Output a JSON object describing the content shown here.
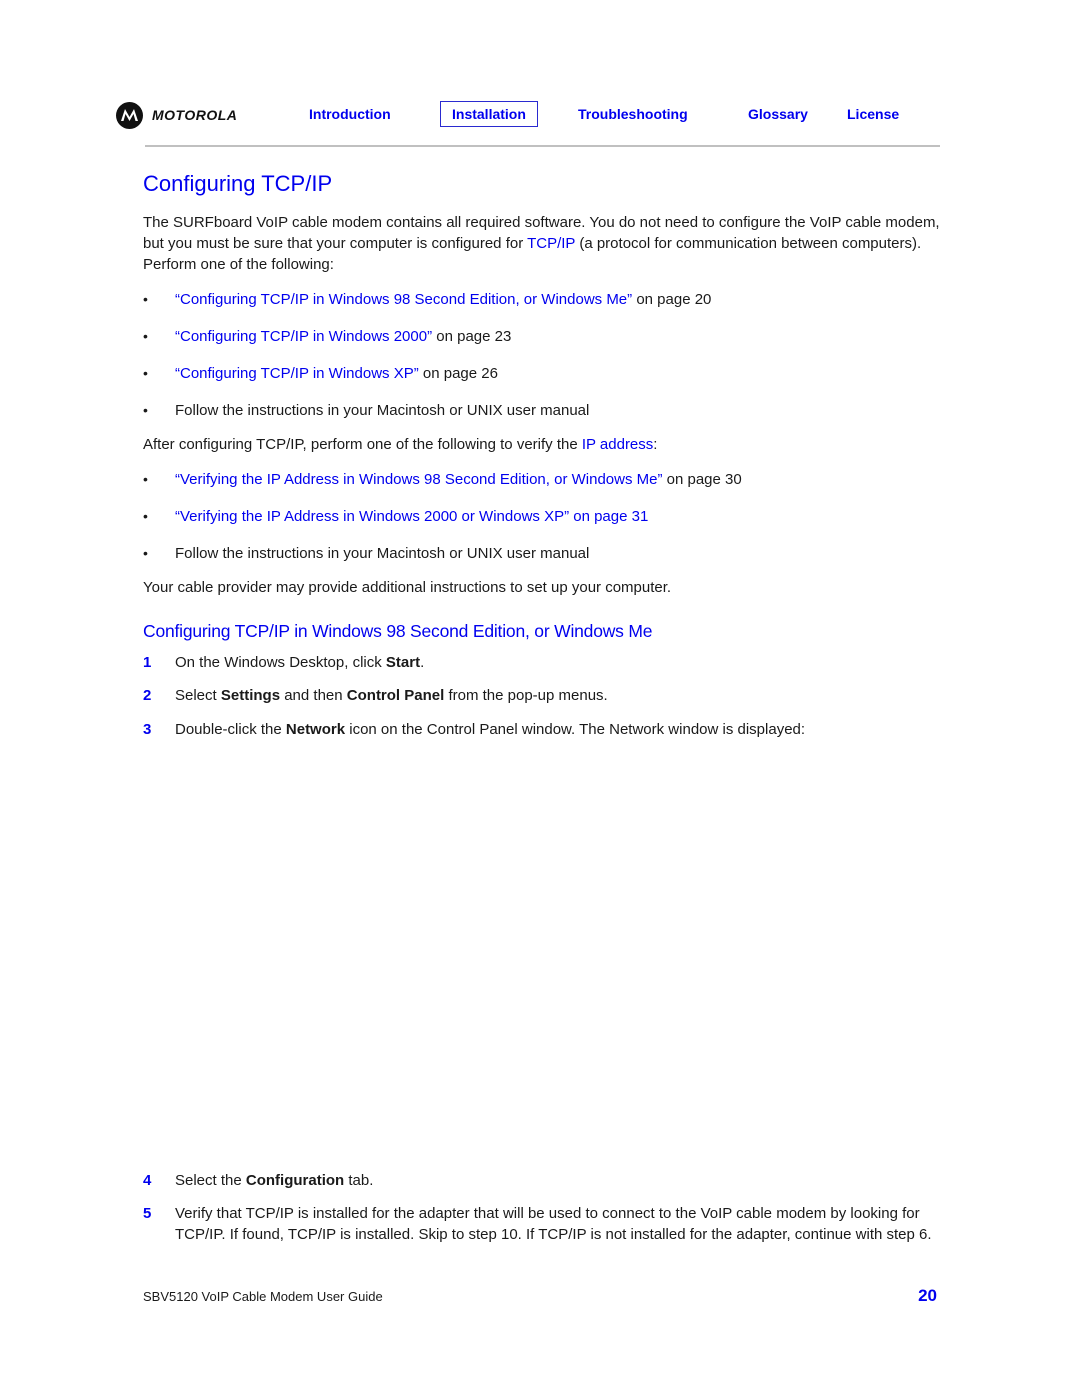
{
  "header": {
    "brand": "MOTOROLA",
    "nav": [
      {
        "label": "Introduction",
        "active": false
      },
      {
        "label": "Installation",
        "active": true
      },
      {
        "label": "Troubleshooting",
        "active": false
      },
      {
        "label": "Glossary",
        "active": false
      },
      {
        "label": "License",
        "active": false
      }
    ]
  },
  "page_title": "Configuring TCP/IP",
  "intro": {
    "before_link": "The SURFboard VoIP cable modem contains all required software. You do not need to configure the VoIP cable modem, but you must be sure that your computer is configured for ",
    "link": "TCP/IP",
    "after_link": " (a protocol for communication between computers). Perform one of the following:"
  },
  "configure_options": [
    {
      "link": "“Configuring TCP/IP in Windows 98 Second Edition, or Windows Me”",
      "suffix": " on page 20"
    },
    {
      "link": "“Configuring TCP/IP in Windows 2000”",
      "suffix": " on page 23"
    },
    {
      "link": "“Configuring TCP/IP in Windows XP”",
      "suffix": " on page 26"
    },
    {
      "link": "",
      "suffix": "Follow the instructions in your Macintosh or UNIX user manual"
    }
  ],
  "verify_intro": {
    "before_link": "After configuring TCP/IP, perform one of the following to verify the ",
    "link": "IP address",
    "after_link": ":"
  },
  "verify_options": [
    {
      "link": "“Verifying the IP Address in Windows 98 Second Edition, or Windows Me”",
      "suffix": " on page 30"
    },
    {
      "link": "“Verifying the IP Address in Windows 2000 or Windows XP” on page 31",
      "suffix": ""
    },
    {
      "link": "",
      "suffix": "Follow the instructions in your Macintosh or UNIX user manual"
    }
  ],
  "provider_note": "Your cable provider may provide additional instructions to set up your computer.",
  "section_heading": "Configuring TCP/IP in Windows 98 Second Edition, or Windows Me",
  "bullet_glyph": "•",
  "steps": [
    {
      "num": "1",
      "parts": [
        {
          "t": "On the Windows Desktop, click "
        },
        {
          "t": "Start",
          "b": true
        },
        {
          "t": "."
        }
      ]
    },
    {
      "num": "2",
      "parts": [
        {
          "t": "Select "
        },
        {
          "t": "Settings",
          "b": true
        },
        {
          "t": " and then "
        },
        {
          "t": "Control Panel",
          "b": true
        },
        {
          "t": " from the pop-up menus."
        }
      ]
    },
    {
      "num": "3",
      "parts": [
        {
          "t": "Double-click the "
        },
        {
          "t": "Network",
          "b": true
        },
        {
          "t": " icon on the Control Panel window. The Network window is displayed:"
        }
      ]
    },
    {
      "num": "4",
      "parts": [
        {
          "t": "Select the "
        },
        {
          "t": "Configuration",
          "b": true
        },
        {
          "t": " tab."
        }
      ]
    },
    {
      "num": "5",
      "parts": [
        {
          "t": "Verify that TCP/IP is installed for the adapter that will be used to connect to the VoIP cable modem by looking for TCP/IP. If found, TCP/IP is installed. Skip to step 10. If TCP/IP is not installed for the adapter, continue with step 6."
        }
      ]
    }
  ],
  "footer": {
    "guide_title": "SBV5120 VoIP Cable Modem User Guide",
    "page_number": "20"
  },
  "colors": {
    "link": "#0000ee",
    "rule": "#c0c0c0",
    "text": "#1a1a1a"
  }
}
